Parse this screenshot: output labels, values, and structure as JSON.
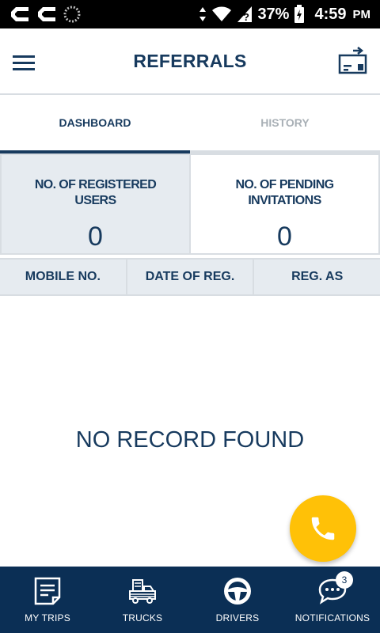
{
  "status_bar": {
    "battery": "37%",
    "time": "4:59",
    "ampm": "PM"
  },
  "app_bar": {
    "title": "REFERRALS"
  },
  "tabs": [
    {
      "label": "DASHBOARD",
      "active": true
    },
    {
      "label": "HISTORY",
      "active": false
    }
  ],
  "stats": {
    "registered_label": "NO. OF REGISTERED USERS",
    "registered_value": "0",
    "pending_label": "NO. OF PENDING INVITATIONS",
    "pending_value": "0"
  },
  "table": {
    "columns": [
      "MOBILE NO.",
      "DATE OF REG.",
      "REG. AS"
    ],
    "empty_text": "NO RECORD FOUND"
  },
  "bottom_nav": [
    {
      "label": "MY TRIPS",
      "icon": "trips-icon"
    },
    {
      "label": "TRUCKS",
      "icon": "truck-icon"
    },
    {
      "label": "DRIVERS",
      "icon": "steering-wheel-icon"
    },
    {
      "label": "NOTIFICATIONS",
      "icon": "chat-icon",
      "badge": "3"
    }
  ],
  "colors": {
    "primary": "#173a5e",
    "nav_background": "#0b2f55",
    "accent": "#ffc107",
    "panel": "#e6ebf0"
  }
}
